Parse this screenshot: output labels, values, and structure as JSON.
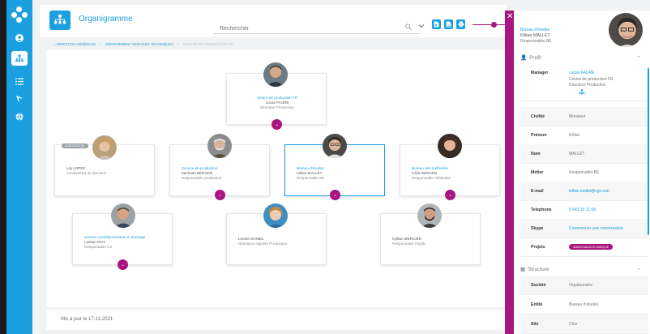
{
  "app": {
    "title": "Organigramme"
  },
  "search": {
    "placeholder": "Rechercher"
  },
  "breadcrumb": {
    "items": [
      "DIRECTION GÉNÉRALE",
      "DÉPARTEMENT SERVICES TECHNIQUES"
    ],
    "current": "CENTRE DE PRODUCTION FR"
  },
  "colors": {
    "accent": "#1a9fe0",
    "magenta": "#a8157e"
  },
  "cards": {
    "root": {
      "dept": "Centre de production FR",
      "name": "Lucas FAURE",
      "role": "Directeur Production"
    },
    "c1": {
      "badge": "Assistant(e)",
      "dept": "",
      "name": "Lily LOPEZ",
      "role": "Assistant(e) de direction"
    },
    "c2": {
      "dept": "Service de production",
      "name": "Zacharis BERGER",
      "role": "Responsable production"
    },
    "c3": {
      "dept": "Bureau d'études",
      "name": "Killian MALLET",
      "role": "Responsable BE"
    },
    "c4": {
      "dept": "Bureau des méthodes",
      "name": "Célia RENARD",
      "role": "Responsable méthodes"
    },
    "c5": {
      "dept": "Service conditionnement et stockage",
      "name": "Lassan ROY",
      "role": "Responsable CS"
    },
    "c6": {
      "name": "Leonie DANIEL",
      "role": "Directrice Adjointe Production"
    },
    "c7": {
      "name": "Kyllian MERCIER",
      "role": "Responsable HQSE"
    }
  },
  "footer": {
    "updated": "Mis à jour le 17-11-2021"
  },
  "panel": {
    "dept": "Bureau d'études",
    "name": "Killian MALLET",
    "role": "Responsable BE",
    "profile_title": "Profil",
    "structure_title": "Structure",
    "manager": {
      "label": "Manager",
      "name": "Lucas FAURE",
      "dept": "Centre de production FR",
      "role": "Directeur Production"
    },
    "fields": [
      {
        "k": "Civilité",
        "v": "Monsieur"
      },
      {
        "k": "Prénom",
        "v": "Killian"
      },
      {
        "k": "Nom",
        "v": "MALLET"
      },
      {
        "k": "Métier",
        "v": "Responsable BE"
      },
      {
        "k": "E-mail",
        "v": "killian.mallet@cgt.com"
      },
      {
        "k": "Telephone",
        "v": "0 643 33 11 68"
      },
      {
        "k": "Skype",
        "v": "Commencer une conversation"
      },
      {
        "k": "Projets",
        "v": "AMBASSADEUR MARQUE"
      }
    ],
    "structure": [
      {
        "k": "Société",
        "v": "Orgatouraine"
      },
      {
        "k": "Entité",
        "v": "Bureau d'études"
      },
      {
        "k": "Site",
        "v": "Cher"
      }
    ]
  }
}
